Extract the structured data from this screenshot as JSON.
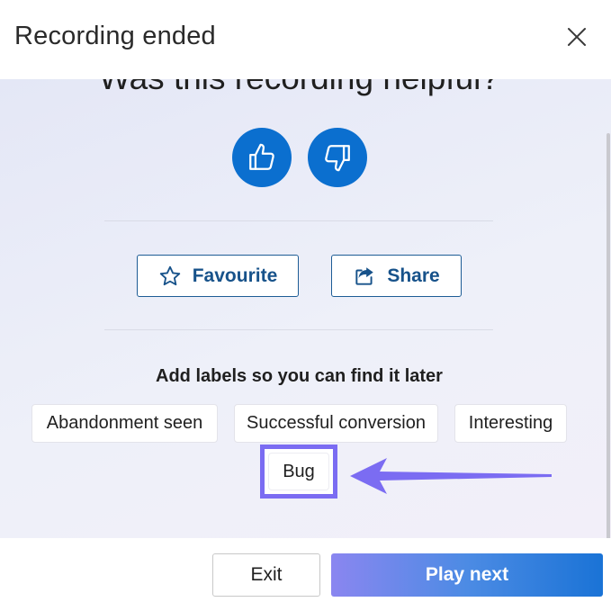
{
  "dialog": {
    "title": "Recording ended",
    "close_icon": "close-icon"
  },
  "feedback": {
    "question": "Was this recording helpful?",
    "thumbs_up_icon": "thumbs-up-icon",
    "thumbs_down_icon": "thumbs-down-icon"
  },
  "actions": {
    "favourite_label": "Favourite",
    "favourite_icon": "star-icon",
    "share_label": "Share",
    "share_icon": "share-icon"
  },
  "labels": {
    "heading": "Add labels so you can find it later",
    "items": [
      {
        "label": "Abandonment seen"
      },
      {
        "label": "Successful conversion"
      },
      {
        "label": "Interesting"
      },
      {
        "label": "Bug",
        "highlighted": true
      }
    ],
    "highlight_color": "#7b6cf2",
    "annotation_arrow_icon": "arrow-left-icon"
  },
  "footer": {
    "exit_label": "Exit",
    "play_next_label": "Play next"
  },
  "colors": {
    "accent": "#0b6fcf",
    "outline_button_text": "#17528a",
    "play_gradient_start": "#8a86f0",
    "play_gradient_end": "#1a73d6"
  }
}
